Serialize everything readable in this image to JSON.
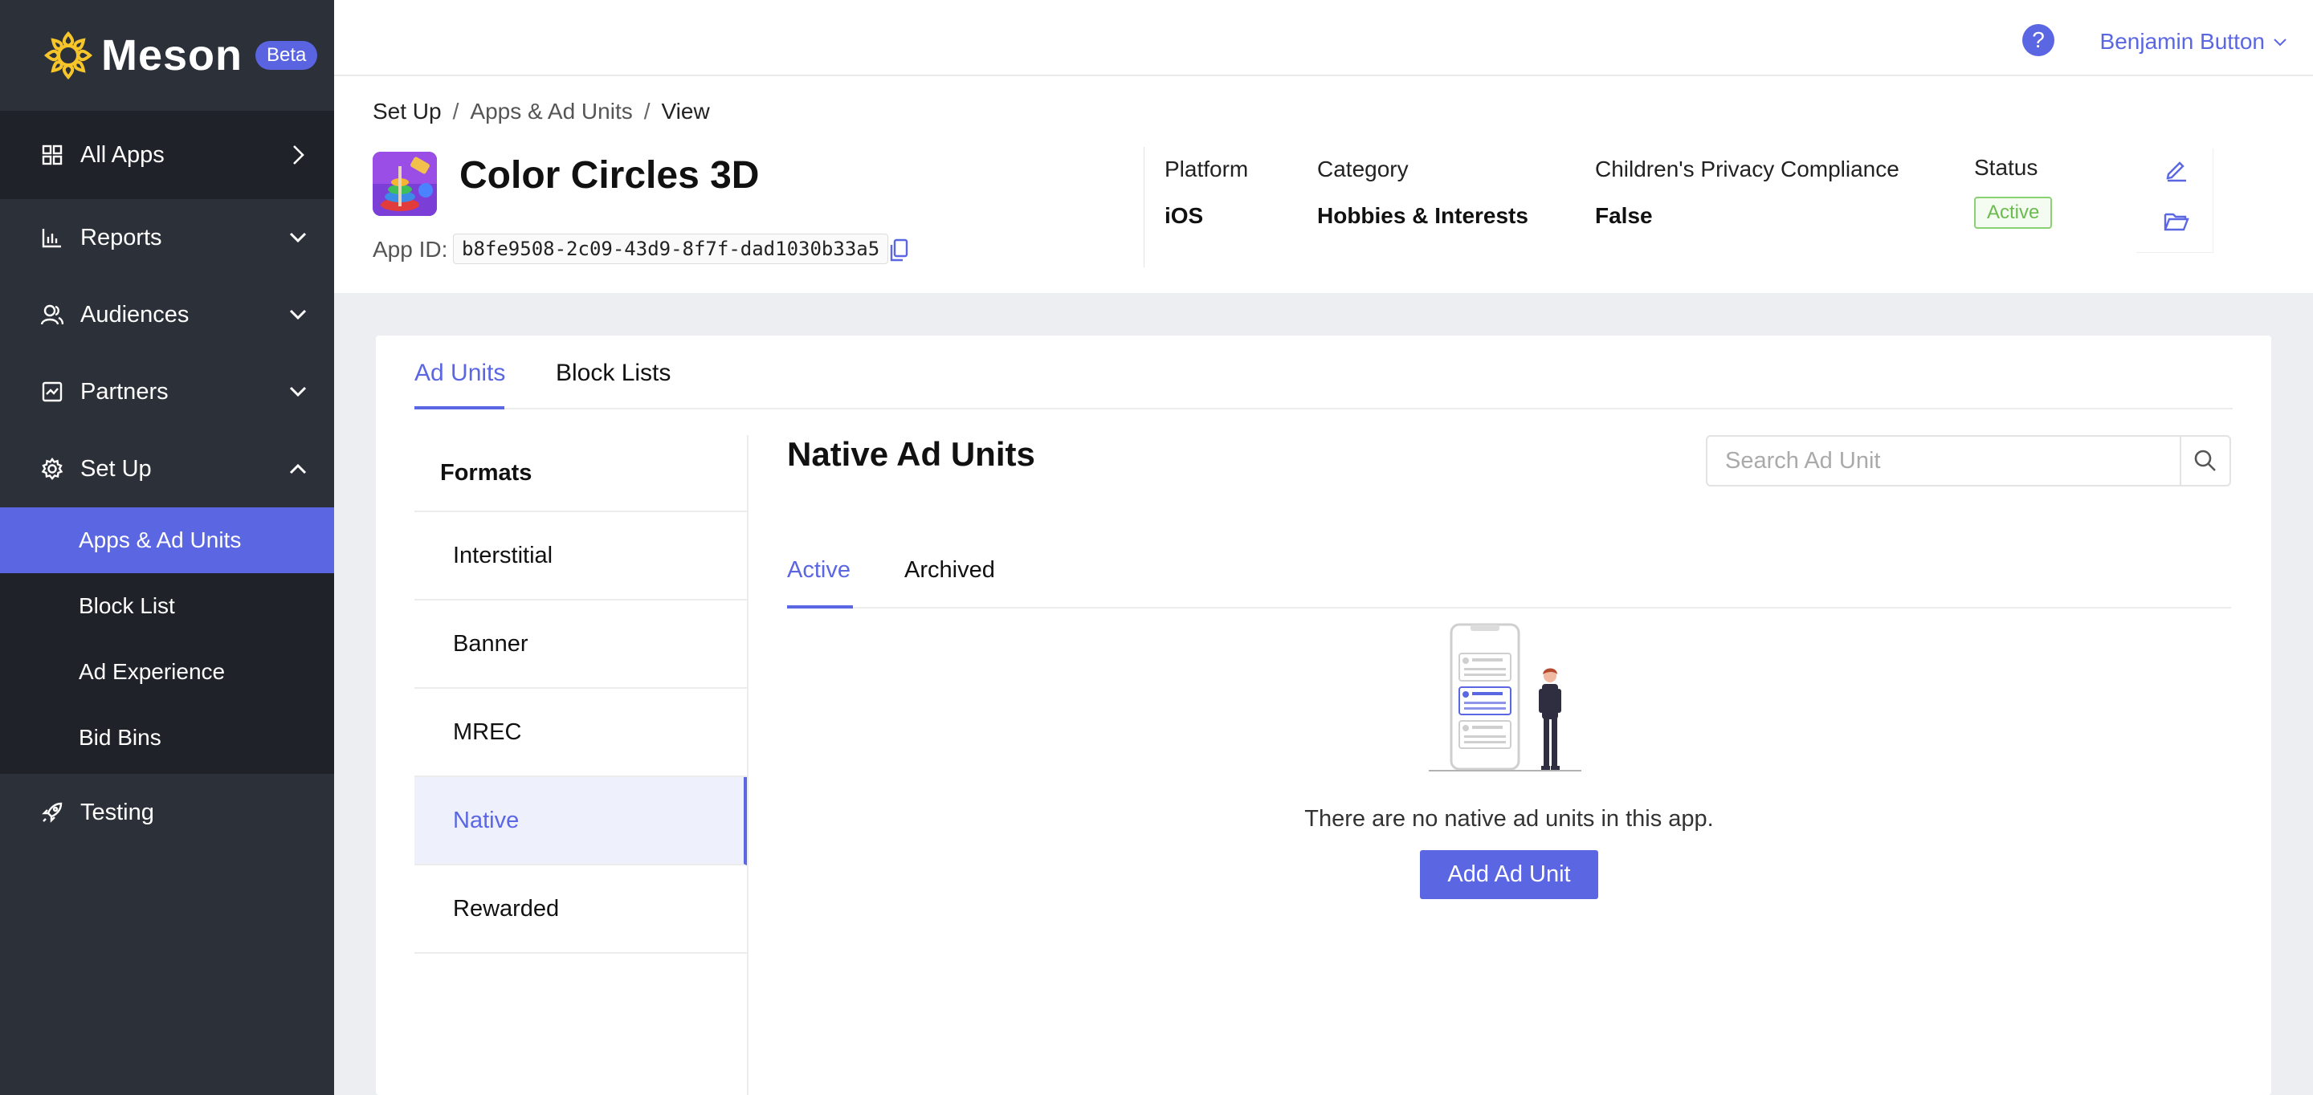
{
  "sidebar": {
    "brand": "Meson",
    "badge": "Beta",
    "items": [
      {
        "label": "All Apps"
      },
      {
        "label": "Reports"
      },
      {
        "label": "Audiences"
      },
      {
        "label": "Partners"
      },
      {
        "label": "Set Up"
      }
    ],
    "setup_sub": [
      {
        "label": "Apps & Ad Units"
      },
      {
        "label": "Block List"
      },
      {
        "label": "Ad Experience"
      },
      {
        "label": "Bid Bins"
      }
    ],
    "testing": "Testing"
  },
  "header": {
    "help": "?",
    "user": "Benjamin Button"
  },
  "breadcrumb": {
    "first": "Set Up",
    "second": "Apps & Ad Units",
    "third": "View",
    "sep": "/"
  },
  "app": {
    "title": "Color Circles 3D",
    "id_label": "App ID:",
    "id": "b8fe9508-2c09-43d9-8f7f-dad1030b33a5",
    "platform_label": "Platform",
    "platform": "iOS",
    "category_label": "Category",
    "category": "Hobbies & Interests",
    "privacy_label": "Children's Privacy Compliance",
    "privacy": "False",
    "status_label": "Status",
    "status": "Active"
  },
  "tabs": {
    "ad_units": "Ad Units",
    "block_lists": "Block Lists"
  },
  "formats": {
    "heading": "Formats",
    "items": [
      "Interstitial",
      "Banner",
      "MREC",
      "Native",
      "Rewarded"
    ]
  },
  "panel": {
    "title": "Native Ad Units",
    "search_placeholder": "Search Ad Unit",
    "tab_active": "Active",
    "tab_archived": "Archived",
    "empty_text": "There are no native ad units in this app.",
    "add_button": "Add Ad Unit"
  }
}
